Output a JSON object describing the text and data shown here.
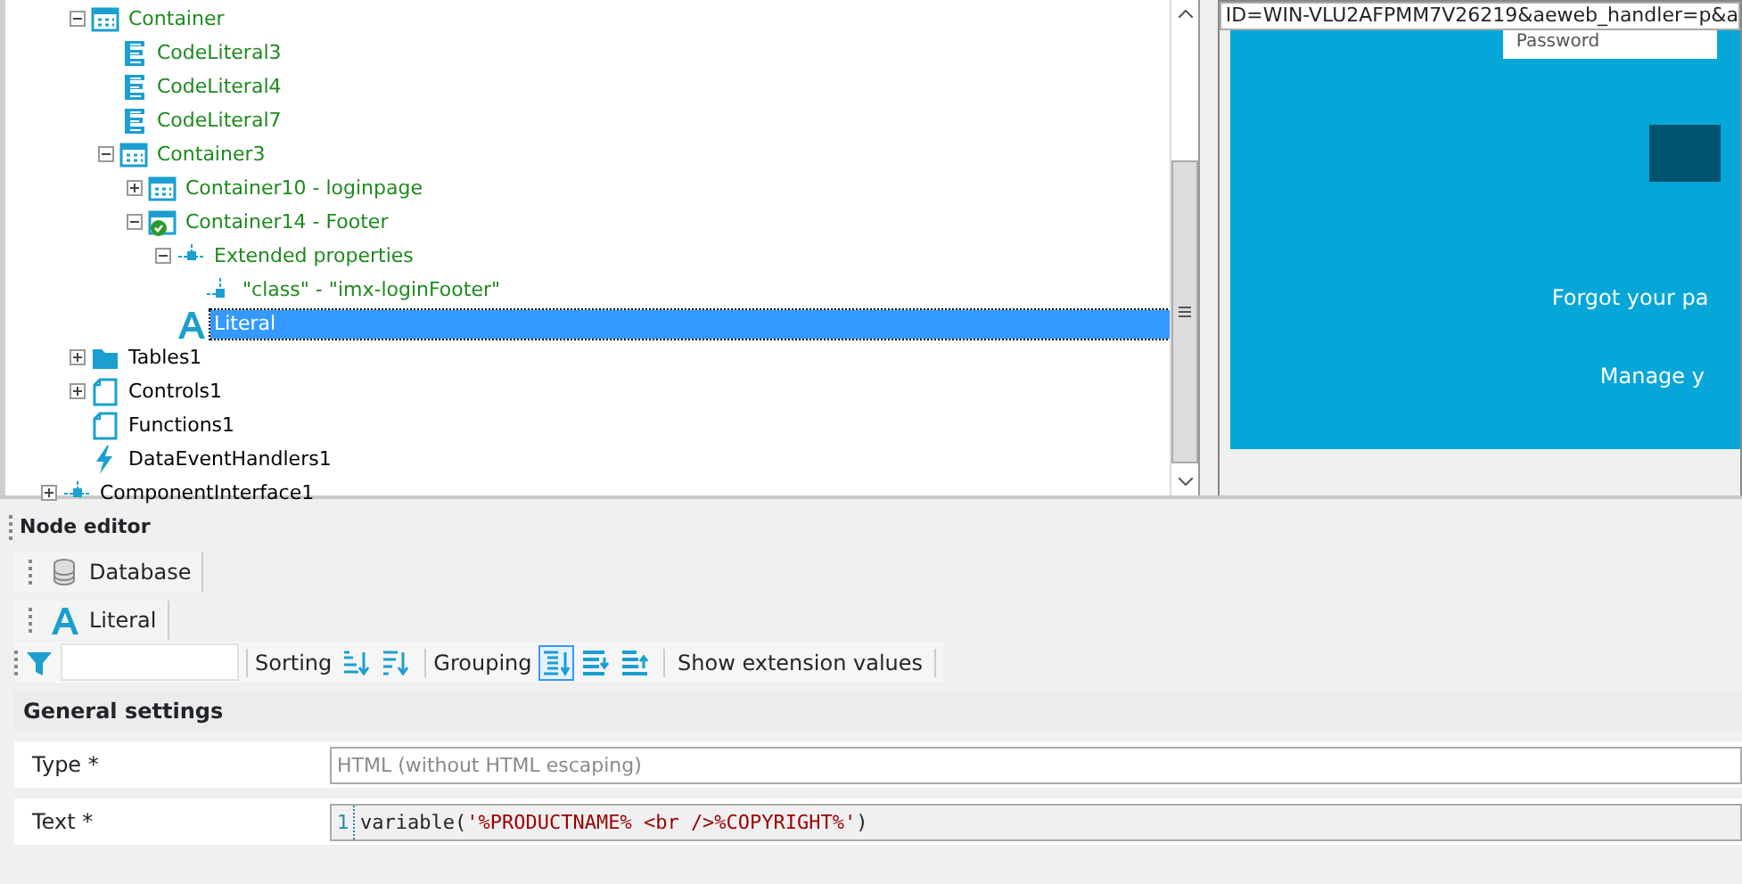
{
  "tree": {
    "items": [
      {
        "label": "Container",
        "kind": "container",
        "expanded": true,
        "color": "#1e8a1e",
        "selected": false,
        "children": [
          {
            "label": "CodeLiteral3",
            "kind": "code",
            "color": "#1e8a1e",
            "selected": false
          },
          {
            "label": "CodeLiteral4",
            "kind": "code",
            "color": "#1e8a1e",
            "selected": false
          },
          {
            "label": "CodeLiteral7",
            "kind": "code",
            "color": "#1e8a1e",
            "selected": false
          },
          {
            "label": "Container3",
            "kind": "container",
            "expanded": true,
            "color": "#1e8a1e",
            "selected": false,
            "children": [
              {
                "label": "Container10 - loginpage",
                "kind": "container",
                "expanded": false,
                "color": "#1e8a1e",
                "selected": false
              },
              {
                "label": "Container14 - Footer",
                "kind": "container-check",
                "expanded": true,
                "color": "#1e8a1e",
                "selected": false,
                "children": [
                  {
                    "label": "Extended properties",
                    "kind": "property-group",
                    "expanded": true,
                    "color": "#1e8a1e",
                    "selected": false,
                    "children": [
                      {
                        "label": "\"class\" - \"imx-loginFooter\"",
                        "kind": "property",
                        "color": "#1e8a1e",
                        "selected": false
                      }
                    ]
                  },
                  {
                    "label": "Literal",
                    "kind": "letter",
                    "selected": true
                  }
                ]
              }
            ]
          }
        ]
      },
      {
        "label": "Tables1",
        "kind": "folder",
        "expanded": false,
        "color": "#000000",
        "selected": false
      },
      {
        "label": "Controls1",
        "kind": "page",
        "expanded": false,
        "color": "#000000",
        "selected": false
      },
      {
        "label": "Functions1",
        "kind": "page",
        "color": "#000000",
        "selected": false
      },
      {
        "label": "DataEventHandlers1",
        "kind": "lightning",
        "color": "#000000",
        "selected": false
      }
    ],
    "root_siblings": [
      {
        "label": "ComponentInterface1",
        "kind": "property-group",
        "expanded": false,
        "color": "#000000",
        "selected": false
      }
    ]
  },
  "preview": {
    "address": "ID=WIN-VLU2AFPMM7V26219&aeweb_handler=p&a",
    "field_label": "Password",
    "links": [
      "Forgot your pa",
      "Manage y"
    ]
  },
  "node_editor": {
    "title": "Node editor",
    "breadcrumbs": [
      {
        "label": "Database",
        "kind": "database"
      },
      {
        "label": "Literal",
        "kind": "letter"
      }
    ],
    "toolbar": [
      {
        "kind": "filter"
      },
      {
        "kind": "label",
        "text": "Sorting"
      },
      {
        "kind": "sort-az",
        "selected": false
      },
      {
        "kind": "sort-za",
        "selected": false
      },
      {
        "kind": "label",
        "text": "Grouping"
      },
      {
        "kind": "group-list",
        "selected": true
      },
      {
        "kind": "group-down",
        "selected": false
      },
      {
        "kind": "group-up",
        "selected": false
      },
      {
        "kind": "button",
        "text": "Show extension values"
      }
    ],
    "section": "General settings",
    "fields": [
      {
        "kind": "text",
        "label": "Type *",
        "value": "HTML (without HTML escaping)",
        "disabled": true
      },
      {
        "kind": "code",
        "label": "Text *",
        "line_number": "1",
        "tokens": [
          {
            "kind": "plain",
            "text": "variable("
          },
          {
            "kind": "string",
            "text": "'%PRODUCTNAME% <br  />%COPYRIGHT%'"
          },
          {
            "kind": "plain",
            "text": ")"
          }
        ]
      }
    ]
  }
}
